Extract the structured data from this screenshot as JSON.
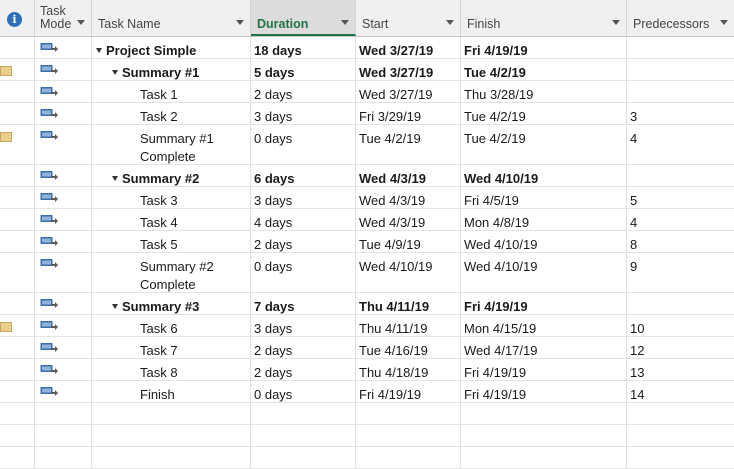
{
  "header": {
    "info_label": "i",
    "task_mode": "Task\nMode",
    "task_name": "Task Name",
    "duration": "Duration",
    "start": "Start",
    "finish": "Finish",
    "predecessors": "Predecessors"
  },
  "colors": {
    "active_accent": "#217346",
    "indicator": "#e9cf8e",
    "mode_icon": "#3f6fa8"
  },
  "rows": [
    {
      "name": "Project Simple",
      "duration": "18 days",
      "start": "Wed 3/27/19",
      "finish": "Fri 4/19/19",
      "pred": "",
      "bold": true,
      "summary": true,
      "level": 0,
      "indicator": false
    },
    {
      "name": "Summary #1",
      "duration": "5 days",
      "start": "Wed 3/27/19",
      "finish": "Tue 4/2/19",
      "pred": "",
      "bold": true,
      "summary": true,
      "level": 1,
      "indicator": true
    },
    {
      "name": "Task 1",
      "duration": "2 days",
      "start": "Wed 3/27/19",
      "finish": "Thu 3/28/19",
      "pred": "",
      "bold": false,
      "summary": false,
      "level": 2,
      "indicator": false
    },
    {
      "name": "Task 2",
      "duration": "3 days",
      "start": "Fri 3/29/19",
      "finish": "Tue 4/2/19",
      "pred": "3",
      "bold": false,
      "summary": false,
      "level": 2,
      "indicator": false
    },
    {
      "name": "Summary #1 Complete",
      "name_line1": "Summary #1",
      "name_line2": "Complete",
      "duration": "0 days",
      "start": "Tue 4/2/19",
      "finish": "Tue 4/2/19",
      "pred": "4",
      "bold": false,
      "summary": false,
      "level": 2,
      "indicator": true,
      "tall": true
    },
    {
      "name": "Summary #2",
      "duration": "6 days",
      "start": "Wed 4/3/19",
      "finish": "Wed 4/10/19",
      "pred": "",
      "bold": true,
      "summary": true,
      "level": 1,
      "indicator": false
    },
    {
      "name": "Task 3",
      "duration": "3 days",
      "start": "Wed 4/3/19",
      "finish": "Fri 4/5/19",
      "pred": "5",
      "bold": false,
      "summary": false,
      "level": 2,
      "indicator": false
    },
    {
      "name": "Task 4",
      "duration": "4 days",
      "start": "Wed 4/3/19",
      "finish": "Mon 4/8/19",
      "pred": "4",
      "bold": false,
      "summary": false,
      "level": 2,
      "indicator": false
    },
    {
      "name": "Task 5",
      "duration": "2 days",
      "start": "Tue 4/9/19",
      "finish": "Wed 4/10/19",
      "pred": "8",
      "bold": false,
      "summary": false,
      "level": 2,
      "indicator": false
    },
    {
      "name": "Summary #2 Complete",
      "name_line1": "Summary #2",
      "name_line2": "Complete",
      "duration": "0 days",
      "start": "Wed 4/10/19",
      "finish": "Wed 4/10/19",
      "pred": "9",
      "bold": false,
      "summary": false,
      "level": 2,
      "indicator": false,
      "tall": true
    },
    {
      "name": "Summary #3",
      "duration": "7 days",
      "start": "Thu 4/11/19",
      "finish": "Fri 4/19/19",
      "pred": "",
      "bold": true,
      "summary": true,
      "level": 1,
      "indicator": false
    },
    {
      "name": "Task 6",
      "duration": "3 days",
      "start": "Thu 4/11/19",
      "finish": "Mon 4/15/19",
      "pred": "10",
      "bold": false,
      "summary": false,
      "level": 2,
      "indicator": true
    },
    {
      "name": "Task 7",
      "duration": "2 days",
      "start": "Tue 4/16/19",
      "finish": "Wed 4/17/19",
      "pred": "12",
      "bold": false,
      "summary": false,
      "level": 2,
      "indicator": false
    },
    {
      "name": "Task 8",
      "duration": "2 days",
      "start": "Thu 4/18/19",
      "finish": "Fri 4/19/19",
      "pred": "13",
      "bold": false,
      "summary": false,
      "level": 2,
      "indicator": false
    },
    {
      "name": "Finish",
      "duration": "0 days",
      "start": "Fri 4/19/19",
      "finish": "Fri 4/19/19",
      "pred": "14",
      "bold": false,
      "summary": false,
      "level": 2,
      "indicator": false
    }
  ]
}
